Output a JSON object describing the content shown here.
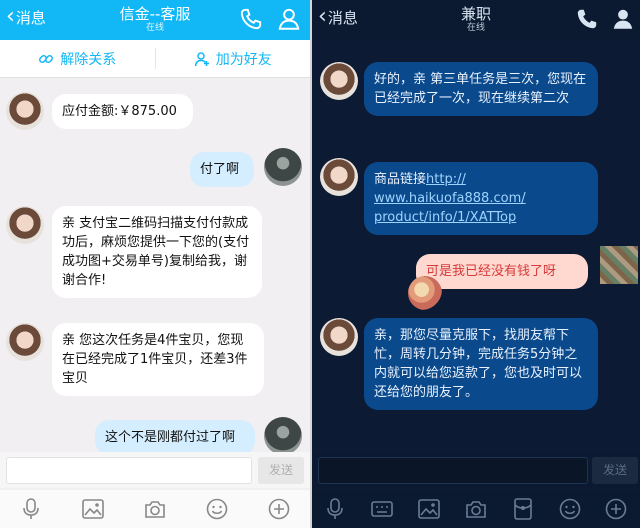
{
  "colors": {
    "qq_blue": "#12b7f5",
    "night_bg": "#0c1b33",
    "out_red": "#d63a3a"
  },
  "left": {
    "header": {
      "back_label": "消息",
      "title": "信金--客服",
      "status": "在线"
    },
    "actions": {
      "unfriend_label": "解除关系",
      "add_friend_label": "加为好友"
    },
    "messages": [
      {
        "side": "in",
        "text": "应付金额:￥875.00"
      },
      {
        "side": "out",
        "text": "付了啊"
      },
      {
        "side": "in",
        "text": "亲 支付宝二维码扫描支付付款成功后，麻烦您提供一下您的(支付成功图+交易单号)复制给我，谢谢合作!"
      },
      {
        "side": "in",
        "text": "亲 您这次任务是4件宝贝，您现在已经完成了1件宝贝，还差3件宝贝"
      },
      {
        "side": "out",
        "text": "这个不是刚都付过了啊"
      }
    ],
    "send_label": "发送",
    "tools": [
      "microphone-icon",
      "image-icon",
      "camera-icon",
      "emoji-icon",
      "plus-icon"
    ]
  },
  "right": {
    "header": {
      "back_label": "消息",
      "title": "兼职",
      "status": "在线"
    },
    "messages": [
      {
        "side": "in",
        "text": "好的，亲 第三单任务是三次，您现在已经完成了一次，现在继续第二次"
      },
      {
        "side": "in",
        "prefix": "商品链接",
        "link_lines": [
          "http://",
          "www.haikuofa888.com/",
          "product/info/1/XATTop"
        ]
      },
      {
        "side": "out",
        "text": "可是我已经没有钱了呀"
      },
      {
        "side": "in",
        "text": "亲，那您尽量克服下，找朋友帮下忙，周转几分钟，完成任务5分钟之内就可以给您返款了，您也及时可以还给您的朋友了。"
      }
    ],
    "send_label": "发送",
    "tools": [
      "microphone-icon",
      "keyboard-icon",
      "image-icon",
      "camera-icon",
      "redpacket-icon",
      "emoji-icon",
      "plus-icon"
    ]
  }
}
